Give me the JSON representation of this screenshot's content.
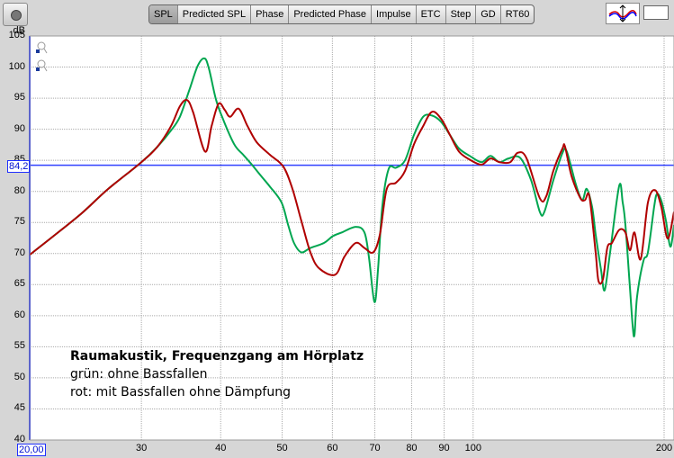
{
  "toolbar": {
    "tabs": [
      "SPL",
      "Predicted SPL",
      "Phase",
      "Predicted Phase",
      "Impulse",
      "ETC",
      "Step",
      "GD",
      "RT60"
    ],
    "active_tab": "SPL"
  },
  "annotation": {
    "title": "Raumakustik, Frequenzgang am Hörplatz",
    "line1": "grün: ohne Bassfallen",
    "line2": "rot: mit Bassfallen ohne Dämpfung"
  },
  "cursor": {
    "y_readout": "84,2",
    "x_readout": "20,00"
  },
  "colors": {
    "green": "#00a650",
    "red": "#b00000",
    "cursor": "#3040ff"
  },
  "chart_data": {
    "type": "line",
    "ylabel": "dB",
    "xscale": "log",
    "xlim": [
      20,
      209
    ],
    "ylim": [
      40,
      105
    ],
    "yticks": [
      40,
      45,
      50,
      55,
      60,
      65,
      70,
      75,
      80,
      85,
      90,
      95,
      100,
      105
    ],
    "xticks": [
      30,
      40,
      50,
      60,
      70,
      80,
      90,
      100,
      200
    ],
    "grid": true,
    "cursor_y": 84.2,
    "series": [
      {
        "name": "grün: ohne Bassfallen",
        "color": "#00a650",
        "x": [
          20,
          21.8,
          24.1,
          26.6,
          30,
          31.8,
          33.4,
          34.5,
          35.7,
          36.8,
          37.7,
          38.3,
          39.3,
          40.2,
          42.0,
          43.4,
          44.8,
          46.3,
          47.8,
          49.9,
          51.1,
          52.2,
          53.6,
          55.4,
          58.2,
          60.1,
          62.1,
          65.3,
          67.4,
          68.5,
          69.9,
          70.8,
          71.9,
          73.6,
          75.6,
          78.1,
          80.7,
          83.4,
          86.1,
          89.0,
          91.9,
          95.0,
          98.8,
          103.1,
          106.5,
          110.0,
          113.7,
          118.6,
          123.4,
          127.4,
          129.5,
          133.8,
          138.3,
          140.5,
          145.2,
          148.6,
          151.0,
          154.0,
          156.0,
          159.1,
          161.2,
          164.4,
          169.9,
          172.1,
          173.8,
          176.7,
          178.4,
          179.6,
          181.3,
          185.5,
          188.6,
          192.9,
          194.9,
          198.0,
          201.3,
          204.6,
          207.3
        ],
        "y": [
          69.8,
          72.8,
          76.4,
          80.4,
          84.7,
          87.2,
          89.8,
          92.0,
          96.3,
          100.2,
          101.4,
          99.9,
          94.9,
          92.0,
          87.6,
          85.9,
          84.3,
          82.5,
          80.8,
          78.2,
          74.6,
          71.7,
          70.2,
          70.9,
          71.7,
          72.8,
          73.4,
          74.3,
          73.4,
          69.5,
          62.2,
          67.3,
          77.5,
          83.6,
          83.8,
          85.0,
          89.1,
          92.0,
          92.2,
          91.2,
          89.1,
          86.9,
          85.7,
          84.7,
          85.7,
          84.7,
          85.3,
          85.4,
          81.8,
          76.7,
          76.7,
          81.8,
          86.2,
          86.4,
          81.1,
          78.6,
          80.4,
          77.5,
          73.1,
          67.3,
          64.1,
          70.2,
          80.9,
          78.2,
          74.6,
          64.4,
          58.5,
          56.9,
          63.0,
          68.8,
          70.2,
          77.5,
          79.6,
          78.5,
          75.3,
          71.1,
          74.6
        ]
      },
      {
        "name": "rot: mit Bassfallen ohne Dämpfung",
        "color": "#b00000",
        "x": [
          20,
          21.8,
          24.1,
          26.6,
          30,
          31.8,
          33.4,
          34.5,
          35.4,
          36.2,
          37.8,
          38.7,
          39.7,
          40.6,
          41.4,
          42.7,
          44.1,
          45.6,
          47.8,
          50.2,
          51.9,
          53.6,
          55.4,
          57.2,
          60.6,
          62.7,
          65.3,
          67.4,
          69.6,
          71.3,
          73.1,
          75.6,
          78.1,
          80.7,
          83.4,
          86.1,
          89.0,
          91.9,
          95.0,
          98.8,
          103.1,
          106.5,
          110.0,
          114.4,
          117.5,
          121.3,
          127.4,
          130.4,
          133.8,
          138.3,
          139.6,
          142.9,
          147.6,
          150.1,
          152.5,
          156.0,
          157.6,
          160.2,
          162.8,
          165.5,
          169.9,
          173.8,
          176.7,
          179.6,
          183.7,
          188.6,
          193.6,
          198.0,
          202.6,
          207.3
        ],
        "y": [
          69.8,
          72.8,
          76.4,
          80.4,
          84.7,
          87.2,
          90.5,
          93.7,
          94.7,
          92.7,
          86.4,
          90.5,
          94.1,
          93.1,
          92.0,
          93.3,
          90.5,
          87.9,
          85.9,
          84.0,
          80.4,
          75.3,
          70.2,
          67.6,
          66.6,
          69.5,
          71.7,
          70.9,
          70.2,
          73.1,
          80.4,
          81.4,
          83.3,
          87.6,
          90.5,
          92.8,
          91.7,
          89.1,
          86.4,
          85.1,
          84.3,
          85.3,
          84.7,
          84.7,
          86.2,
          85.4,
          78.9,
          79.2,
          83.3,
          86.9,
          87.2,
          82.5,
          78.9,
          78.6,
          79.2,
          70.2,
          65.6,
          65.9,
          71.0,
          71.7,
          73.8,
          73.4,
          70.5,
          73.4,
          69.1,
          78.2,
          80.2,
          77.5,
          72.4,
          76.7
        ]
      }
    ]
  }
}
